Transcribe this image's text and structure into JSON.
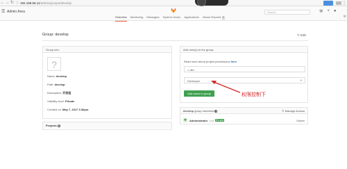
{
  "browser": {
    "url_host": "192.168.56.11",
    "url_path": "/admin/groups/develop"
  },
  "header": {
    "admin_title": "Admin Area",
    "search_placeholder": "Search"
  },
  "nav": {
    "items": [
      "Overview",
      "Monitoring",
      "Messages",
      "System Hooks",
      "Applications",
      "Abuse Reports"
    ],
    "abuse_count": "0"
  },
  "page": {
    "title": "Group: develop",
    "edit_label": "Edit"
  },
  "group_info": {
    "heading": "Group info:",
    "avatar_glyph": "?",
    "name_label": "Name:",
    "name_value": "develop",
    "path_label": "Path:",
    "path_value": "develop",
    "desc_label": "Description:",
    "desc_value": "开发组",
    "visibility_label": "Visibility level:",
    "visibility_value": "Private",
    "created_label": "Created on:",
    "created_value": "May 7, 2017 3:36pm"
  },
  "projects": {
    "heading": "Projects",
    "count": "0"
  },
  "add_user": {
    "heading": "Add user(s) to the group:",
    "help_text": "Read more about project permissions",
    "help_link": "here",
    "user_value": "× dev",
    "role_value": "Developer",
    "button_label": "Add users to group"
  },
  "annotation": {
    "text": "权限控制下",
    "color": "#d42a2a"
  },
  "members": {
    "heading_group": "develop",
    "heading_rest": "group members",
    "count": "1",
    "manage_label": "Manage Access",
    "rows": [
      {
        "name": "Administrator",
        "username": "root",
        "badge": "It's you",
        "role": "Owner"
      }
    ]
  },
  "colors": {
    "accent": "#e75e40",
    "primary_green": "#3fa14f",
    "link_blue": "#1b69b6"
  }
}
